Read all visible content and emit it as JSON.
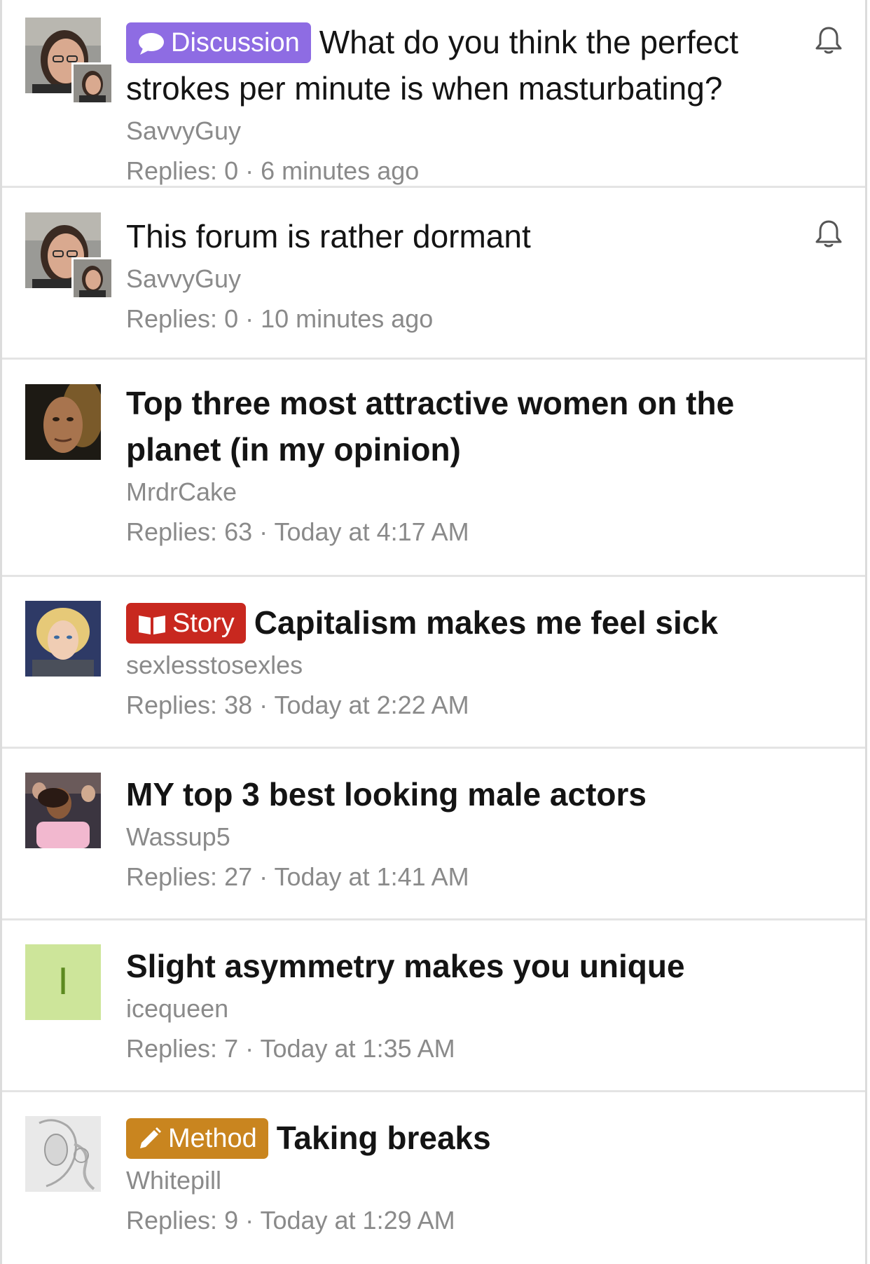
{
  "threads": [
    {
      "prefix": "Discussion",
      "prefix_color": "#8e6ce3",
      "prefix_icon": "speech-bubble-icon",
      "title": "What do you think the perfect strokes per minute is when masturbating?",
      "author": "SavvyGuy",
      "replies_label": "Replies: 0",
      "time": "6 minutes ago",
      "watched": true,
      "avatar": "photo-man-glasses",
      "has_mini_avatar": true
    },
    {
      "prefix": "",
      "title": "This forum is rather dormant",
      "author": "SavvyGuy",
      "replies_label": "Replies: 0",
      "time": "10 minutes ago",
      "watched": true,
      "avatar": "photo-man-glasses",
      "has_mini_avatar": true
    },
    {
      "prefix": "",
      "title": "Top three most attractive women on the planet (in my opinion)",
      "author": "MrdrCake",
      "replies_label": "Replies: 63",
      "time": "Today at 4:17 AM",
      "watched": false,
      "avatar": "photo-movie-character",
      "has_mini_avatar": false
    },
    {
      "prefix": "Story",
      "prefix_color": "#c8281f",
      "prefix_icon": "open-book-icon",
      "title": "Capitalism makes me feel sick",
      "author": "sexlesstosexles",
      "replies_label": "Replies: 38",
      "time": "Today at 2:22 AM",
      "watched": false,
      "avatar": "photo-game-character",
      "has_mini_avatar": false
    },
    {
      "prefix": "",
      "title": "MY top 3 best looking male actors",
      "author": "Wassup5",
      "replies_label": "Replies: 27",
      "time": "Today at 1:41 AM",
      "watched": false,
      "avatar": "photo-woman-pink-shirt",
      "has_mini_avatar": false
    },
    {
      "prefix": "",
      "title": "Slight asymmetry makes you unique",
      "author": "icequeen",
      "replies_label": "Replies: 7",
      "time": "Today at 1:35 AM",
      "watched": false,
      "avatar": "letter-avatar",
      "avatar_letter": "I",
      "avatar_bg": "#cde59a",
      "avatar_fg": "#5c8a1f",
      "has_mini_avatar": false
    },
    {
      "prefix": "Method",
      "prefix_color": "#c9851f",
      "prefix_icon": "pencil-icon",
      "title": "Taking breaks",
      "author": "Whitepill",
      "replies_label": "Replies: 9",
      "time": "Today at 1:29 AM",
      "watched": false,
      "avatar": "photo-sketch-drawing",
      "has_mini_avatar": false
    }
  ],
  "meta_separator": "·"
}
